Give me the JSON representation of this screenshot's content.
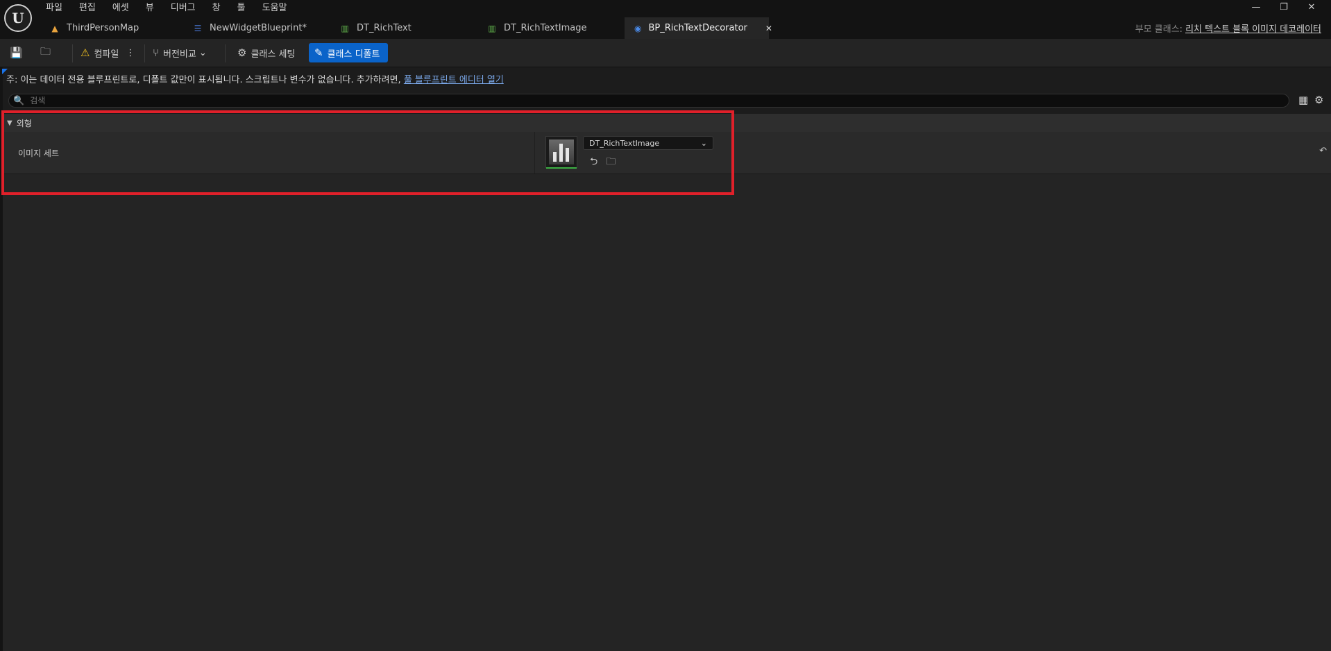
{
  "menu": [
    "파일",
    "편집",
    "에셋",
    "뷰",
    "디버그",
    "창",
    "툴",
    "도움말"
  ],
  "tabs": [
    {
      "label": "ThirdPersonMap",
      "icon": "map-icon",
      "color": "#e8a33d"
    },
    {
      "label": "NewWidgetBlueprint*",
      "icon": "widget-blueprint-icon",
      "color": "#4a78d8"
    },
    {
      "label": "DT_RichText",
      "icon": "data-table-icon",
      "color": "#5fb04a"
    },
    {
      "label": "DT_RichTextImage",
      "icon": "data-table-icon",
      "color": "#5fb04a"
    },
    {
      "label": "BP_RichTextDecorator",
      "icon": "blueprint-class-icon",
      "color": "#4a8ae8",
      "active": true
    }
  ],
  "parent_class": {
    "prefix": "부모 클래스:",
    "name": "리치 텍스트 블록 이미지 데코레이터"
  },
  "toolbar": {
    "compile_label": "컴파일",
    "diff_label": "버전비교",
    "class_settings_label": "클래스 세팅",
    "class_defaults_label": "클래스 디폴트"
  },
  "note": {
    "text": "주: 이는 데이터 전용 블루프린트로, 디폴트 값만이 표시됩니다. 스크립트나 변수가 없습니다. 추가하려면,",
    "link": "풀 블루프린트 에디터 열기"
  },
  "search": {
    "placeholder": "검색"
  },
  "details": {
    "category": "외형",
    "property_label": "이미지 세트",
    "property_value": "DT_RichTextImage"
  },
  "accent_color": "#0a63c9",
  "highlight_color": "#e0202a"
}
